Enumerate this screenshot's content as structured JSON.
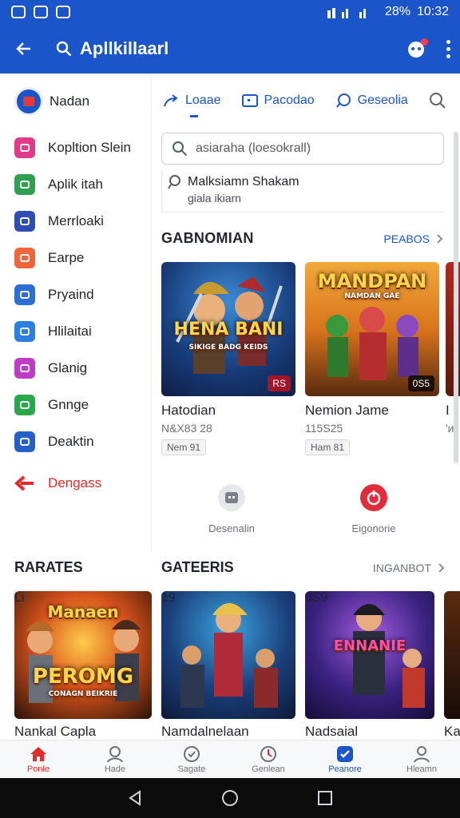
{
  "status_bar": {
    "signal_text": "28%",
    "time": "10:32"
  },
  "app_bar": {
    "title": "Apllkillaarl",
    "back_icon": "arrow-left-icon",
    "search_icon": "search-icon",
    "notifications_icon": "notification-icon",
    "more_icon": "more-vertical-icon"
  },
  "sidebar": {
    "profile": {
      "label": "Nadan",
      "icon": "avatar-icon"
    },
    "items": [
      {
        "label": "Kopltion Slein",
        "icon": "tv-icon",
        "color": "#e13b8a"
      },
      {
        "label": "Aplik itah",
        "icon": "game-icon",
        "color": "#2ea04f"
      },
      {
        "label": "Merrloaki",
        "icon": "puzzle-icon",
        "color": "#2e4db4"
      },
      {
        "label": "Earpe",
        "icon": "chat-icon",
        "color": "#f0663a"
      },
      {
        "label": "Pryaind",
        "icon": "camera-icon",
        "color": "#2b6fd6"
      },
      {
        "label": "Hlilaitai",
        "icon": "mail-icon",
        "color": "#2b7fe0"
      },
      {
        "label": "Glanig",
        "icon": "tag-icon",
        "color": "#c03cc8"
      },
      {
        "label": "Gnnge",
        "icon": "check-icon",
        "color": "#27a84a"
      },
      {
        "label": "Deaktin",
        "icon": "lock-icon",
        "color": "#2560c8"
      }
    ],
    "danger_item": {
      "label": "Dengass",
      "icon": "arrow-left-icon",
      "color": "#e32b2b"
    }
  },
  "tabs": [
    {
      "label": "Loaae",
      "icon": "share-icon"
    },
    {
      "label": "Pacodao",
      "icon": "window-icon"
    },
    {
      "label": "Geseolia",
      "icon": "comment-icon"
    }
  ],
  "search": {
    "placeholder": "asiaraha (loesokrall)"
  },
  "suggestion": {
    "title": "Malksiamn Shakam",
    "subtitle": "giala ikiarn"
  },
  "section1": {
    "title": "GABNOMIAN",
    "link": "PEABOS",
    "cards": [
      {
        "name": "Hatodian",
        "meta": "N&X83 28",
        "chip": "Nem 91",
        "badge": "RS",
        "thumb_title": "HENA BANI",
        "thumb_sub": "SIKIGE BADG KEIDS"
      },
      {
        "name": "Nemion Jame",
        "meta": "115S25",
        "chip": "Ham 81",
        "badge": "0S5",
        "thumb_title": "MANDPAN",
        "thumb_sub": "NAMDAN GAE"
      },
      {
        "name": "I",
        "meta": "'и",
        "chip": "",
        "badge": "",
        "thumb_title": "",
        "thumb_sub": ""
      }
    ]
  },
  "quick_actions": [
    {
      "label": "Desenalin",
      "icon": "robot-icon"
    },
    {
      "label": "Eigonorie",
      "icon": "power-icon"
    }
  ],
  "section2": {
    "left_title": "RARATES",
    "title": "GATEERIS",
    "link": "INGANBOT",
    "cards": [
      {
        "name": "Nankal Capla",
        "badge": "Li",
        "thumb_title": "PEROMG",
        "thumb_top": "Manaen",
        "thumb_sub": "CONAGN BEIKRIE"
      },
      {
        "name": "Namdalnelaan",
        "badge": "19",
        "thumb_title": "",
        "thumb_top": "",
        "thumb_sub": ""
      },
      {
        "name": "Nadsaial",
        "badge": "0S9",
        "thumb_title": "ENNANIE",
        "thumb_top": "",
        "thumb_sub": ""
      },
      {
        "name": "Ka",
        "badge": "",
        "thumb_title": "",
        "thumb_top": "",
        "thumb_sub": ""
      }
    ]
  },
  "bottom_nav": [
    {
      "label": "Ponle",
      "icon": "home-icon"
    },
    {
      "label": "Hade",
      "icon": "user-icon"
    },
    {
      "label": "Sagate",
      "icon": "shield-icon"
    },
    {
      "label": "Genlean",
      "icon": "clock-icon"
    },
    {
      "label": "Peanore",
      "icon": "check-badge-icon"
    },
    {
      "label": "Hleamn",
      "icon": "person-icon"
    }
  ],
  "system_nav": {
    "back_icon": "triangle-back-icon",
    "home_icon": "circle-home-icon",
    "recents_icon": "square-recents-icon"
  }
}
